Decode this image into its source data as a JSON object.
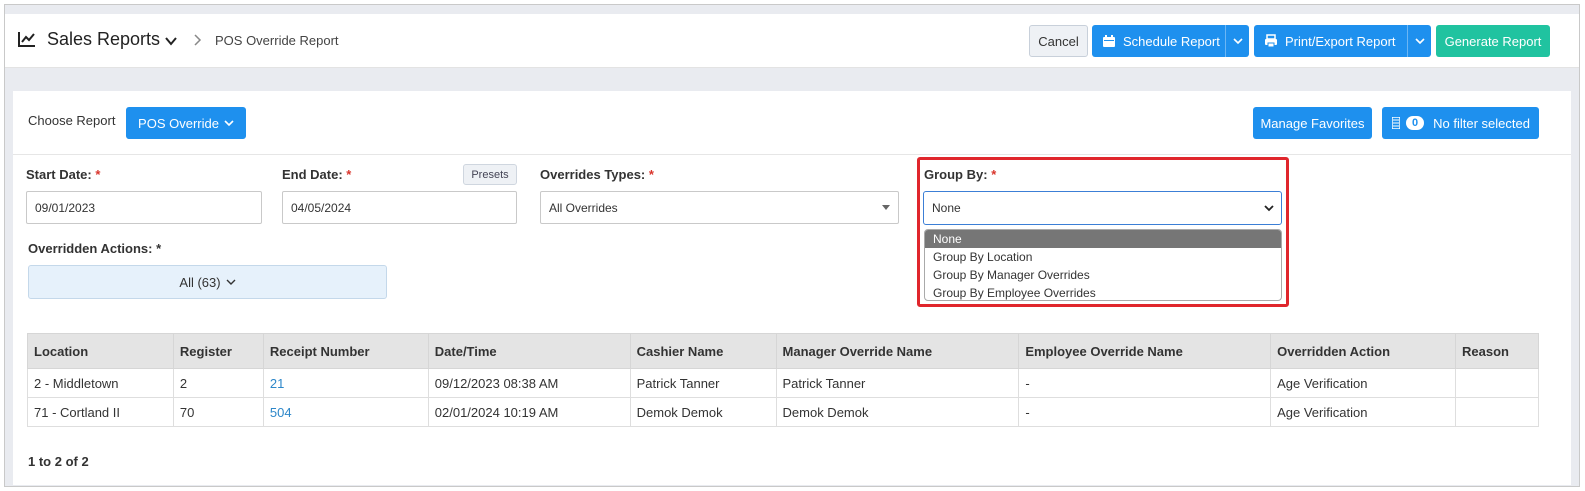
{
  "header": {
    "title": "Sales Reports",
    "breadcrumb": "POS Override Report",
    "cancel_label": "Cancel",
    "schedule_label": "Schedule Report",
    "print_label": "Print/Export Report",
    "generate_label": "Generate Report"
  },
  "toolbar": {
    "choose_report_label": "Choose Report",
    "report_button_label": "POS Override",
    "manage_favorites_label": "Manage Favorites",
    "filter_count": "0",
    "filter_label": "No filter selected"
  },
  "filters": {
    "start_date_label": "Start Date:",
    "start_date_value": "09/01/2023",
    "end_date_label": "End Date:",
    "end_date_value": "04/05/2024",
    "presets_label": "Presets",
    "override_types_label": "Overrides Types:",
    "override_types_value": "All Overrides",
    "group_by_label": "Group By:",
    "group_by_value": "None",
    "group_by_options": [
      "None",
      "Group By Location",
      "Group By Manager Overrides",
      "Group By Employee Overrides"
    ],
    "overridden_actions_label": "Overridden Actions:",
    "overridden_actions_value": "All (63)",
    "required_mark": "*"
  },
  "table": {
    "columns": [
      "Location",
      "Register",
      "Receipt Number",
      "Date/Time",
      "Cashier Name",
      "Manager Override Name",
      "Employee Override Name",
      "Overridden Action",
      "Reason"
    ],
    "rows": [
      [
        "2 - Middletown",
        "2",
        "21",
        "09/12/2023 08:38 AM",
        "Patrick Tanner",
        "Patrick Tanner",
        "-",
        "Age Verification",
        ""
      ],
      [
        "71 - Cortland II",
        "70",
        "504",
        "02/01/2024 10:19 AM",
        "Demok Demok",
        "Demok Demok",
        "-",
        "Age Verification",
        ""
      ]
    ],
    "pagination": "1 to 2 of 2"
  },
  "colors": {
    "primary": "#1e90ee",
    "success": "#20c3a0",
    "highlight": "#e0262c",
    "link": "#2d87c9"
  }
}
